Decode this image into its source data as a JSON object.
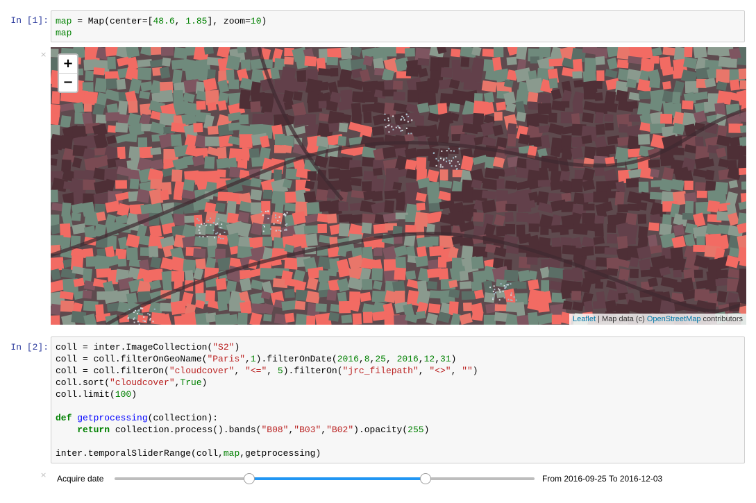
{
  "cells": [
    {
      "prompt": "In [1]:",
      "lines": [
        [
          {
            "t": "map",
            "c": "var"
          },
          {
            "t": " = Map(center=[",
            "c": ""
          },
          {
            "t": "48.6",
            "c": "num"
          },
          {
            "t": ", ",
            "c": ""
          },
          {
            "t": "1.85",
            "c": "num"
          },
          {
            "t": "], zoom=",
            "c": ""
          },
          {
            "t": "10",
            "c": "num"
          },
          {
            "t": ")",
            "c": ""
          }
        ],
        [
          {
            "t": "map",
            "c": "var"
          }
        ]
      ]
    },
    {
      "prompt": "In [2]:",
      "lines": [
        [
          {
            "t": "coll = inter.ImageCollection(",
            "c": ""
          },
          {
            "t": "\"S2\"",
            "c": "str"
          },
          {
            "t": ")",
            "c": ""
          }
        ],
        [
          {
            "t": "coll = coll.filterOnGeoName(",
            "c": ""
          },
          {
            "t": "\"Paris\"",
            "c": "str"
          },
          {
            "t": ",",
            "c": ""
          },
          {
            "t": "1",
            "c": "num"
          },
          {
            "t": ").filterOnDate(",
            "c": ""
          },
          {
            "t": "2016",
            "c": "num"
          },
          {
            "t": ",",
            "c": ""
          },
          {
            "t": "8",
            "c": "num"
          },
          {
            "t": ",",
            "c": ""
          },
          {
            "t": "25",
            "c": "num"
          },
          {
            "t": ", ",
            "c": ""
          },
          {
            "t": "2016",
            "c": "num"
          },
          {
            "t": ",",
            "c": ""
          },
          {
            "t": "12",
            "c": "num"
          },
          {
            "t": ",",
            "c": ""
          },
          {
            "t": "31",
            "c": "num"
          },
          {
            "t": ")",
            "c": ""
          }
        ],
        [
          {
            "t": "coll = coll.filterOn(",
            "c": ""
          },
          {
            "t": "\"cloudcover\"",
            "c": "str"
          },
          {
            "t": ", ",
            "c": ""
          },
          {
            "t": "\"<=\"",
            "c": "str"
          },
          {
            "t": ", ",
            "c": ""
          },
          {
            "t": "5",
            "c": "num"
          },
          {
            "t": ").filterOn(",
            "c": ""
          },
          {
            "t": "\"jrc_filepath\"",
            "c": "str"
          },
          {
            "t": ", ",
            "c": ""
          },
          {
            "t": "\"<>\"",
            "c": "str"
          },
          {
            "t": ", ",
            "c": ""
          },
          {
            "t": "\"\"",
            "c": "str"
          },
          {
            "t": ")",
            "c": ""
          }
        ],
        [
          {
            "t": "coll.sort(",
            "c": ""
          },
          {
            "t": "\"cloudcover\"",
            "c": "str"
          },
          {
            "t": ",",
            "c": ""
          },
          {
            "t": "True",
            "c": "num"
          },
          {
            "t": ")",
            "c": ""
          }
        ],
        [
          {
            "t": "coll.limit(",
            "c": ""
          },
          {
            "t": "100",
            "c": "num"
          },
          {
            "t": ")",
            "c": ""
          }
        ],
        [],
        [
          {
            "t": "def",
            "c": "kw"
          },
          {
            "t": " ",
            "c": ""
          },
          {
            "t": "getprocessing",
            "c": "fn"
          },
          {
            "t": "(collection):",
            "c": ""
          }
        ],
        [
          {
            "t": "    ",
            "c": ""
          },
          {
            "t": "return",
            "c": "kw"
          },
          {
            "t": " collection.process().bands(",
            "c": ""
          },
          {
            "t": "\"B08\"",
            "c": "str"
          },
          {
            "t": ",",
            "c": ""
          },
          {
            "t": "\"B03\"",
            "c": "str"
          },
          {
            "t": ",",
            "c": ""
          },
          {
            "t": "\"B02\"",
            "c": "str"
          },
          {
            "t": ").opacity(",
            "c": ""
          },
          {
            "t": "255",
            "c": "num"
          },
          {
            "t": ")",
            "c": ""
          }
        ],
        [],
        [
          {
            "t": "inter.temporalSliderRange(coll,",
            "c": ""
          },
          {
            "t": "map",
            "c": "var"
          },
          {
            "t": ",getprocessing)",
            "c": ""
          }
        ]
      ]
    }
  ],
  "map": {
    "zoom_in": "+",
    "zoom_out": "−",
    "attribution_leaflet": "Leaflet",
    "attribution_sep": " | Map data (c) ",
    "attribution_osm": "OpenStreetMap",
    "attribution_tail": " contributors"
  },
  "output_close": "×",
  "slider": {
    "label": "Acquire date",
    "readout": "From 2016-09-25 To 2016-12-03",
    "range_start_fraction": 0.32,
    "range_end_fraction": 0.74
  },
  "colors": {
    "field_red": "#f26b63",
    "field_green": "#6f8a7c",
    "forest": "#5a3a40",
    "accent": "#2196f3"
  }
}
